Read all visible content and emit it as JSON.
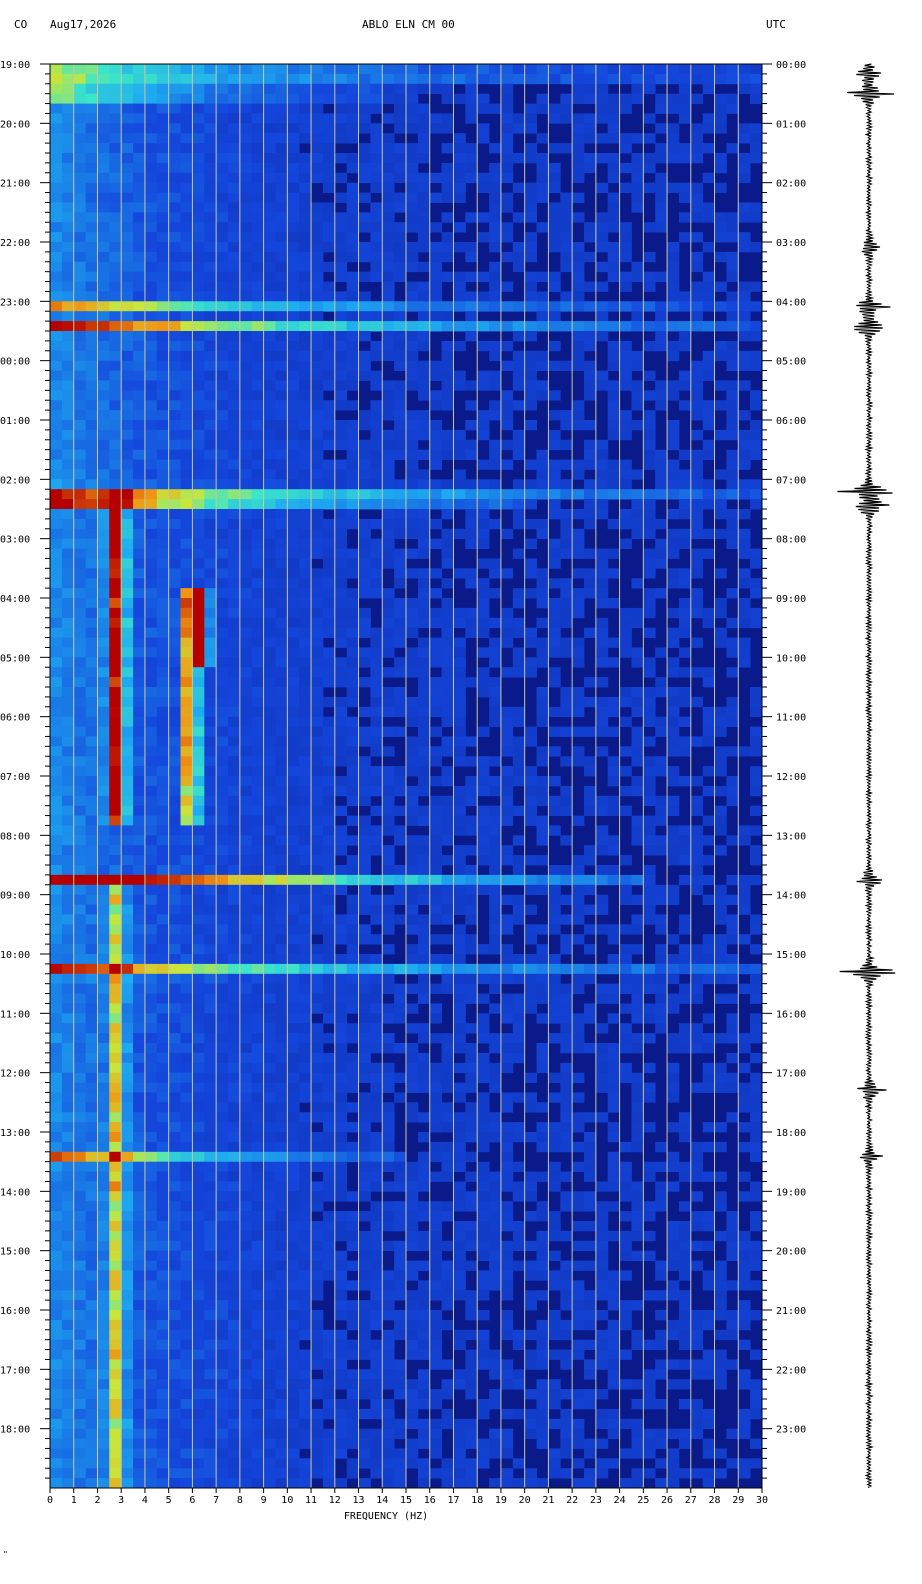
{
  "header": {
    "network": "CO",
    "date": "Aug17,2026",
    "station": "ABLO ELN CM 00",
    "timezone": "UTC"
  },
  "footer_mark": "\"",
  "colors": {
    "background": "#0a1a8a",
    "high": "#b40000",
    "gridline": "#c8c8a0"
  },
  "chart_data": {
    "type": "heatmap",
    "title": "ABLO ELN CM 00",
    "xlabel": "FREQUENCY (HZ)",
    "ylabel": "",
    "xlim": [
      0,
      30
    ],
    "x_ticks": [
      "0",
      "1",
      "2",
      "3",
      "4",
      "5",
      "6",
      "7",
      "8",
      "9",
      "10",
      "11",
      "12",
      "13",
      "14",
      "15",
      "16",
      "17",
      "18",
      "19",
      "20",
      "21",
      "22",
      "23",
      "24",
      "25",
      "26",
      "27",
      "28",
      "29",
      "30"
    ],
    "left_time_labels": [
      "19:00",
      "20:00",
      "21:00",
      "22:00",
      "23:00",
      "00:00",
      "01:00",
      "02:00",
      "03:00",
      "04:00",
      "05:00",
      "06:00",
      "07:00",
      "08:00",
      "09:00",
      "10:00",
      "11:00",
      "12:00",
      "13:00",
      "14:00",
      "15:00",
      "16:00",
      "17:00",
      "18:00"
    ],
    "right_time_labels": [
      "00:00",
      "01:00",
      "02:00",
      "03:00",
      "04:00",
      "05:00",
      "06:00",
      "07:00",
      "08:00",
      "09:00",
      "10:00",
      "11:00",
      "12:00",
      "13:00",
      "14:00",
      "15:00",
      "16:00",
      "17:00",
      "18:00",
      "19:00",
      "20:00",
      "21:00",
      "22:00",
      "23:00"
    ],
    "hours_span": 24,
    "energy_events": [
      {
        "hour": 0.17,
        "intensity": 0.95,
        "fmax": 30
      },
      {
        "hour": 0.5,
        "intensity": 0.85,
        "fmax": 14
      },
      {
        "hour": 4.1,
        "intensity": 0.5,
        "fmax": 30
      },
      {
        "hour": 4.45,
        "intensity": 0.85,
        "fmax": 30
      },
      {
        "hour": 7.2,
        "intensity": 1.0,
        "fmax": 30
      },
      {
        "hour": 7.45,
        "intensity": 0.85,
        "fmax": 20
      },
      {
        "hour": 13.75,
        "intensity": 0.85,
        "fmax": 25
      },
      {
        "hour": 15.3,
        "intensity": 1.0,
        "fmax": 30
      },
      {
        "hour": 18.4,
        "intensity": 0.6,
        "fmax": 15
      }
    ],
    "persistent_bands": [
      {
        "freq_hz": 2.8,
        "start_hour": 7.2,
        "end_hour": 12.8,
        "intensity": 0.85
      },
      {
        "freq_hz": 5.9,
        "start_hour": 8.8,
        "end_hour": 12.8,
        "intensity": 0.75
      },
      {
        "freq_hz": 6.3,
        "start_hour": 8.8,
        "end_hour": 10.2,
        "intensity": 0.8
      },
      {
        "freq_hz": 2.8,
        "start_hour": 13.6,
        "end_hour": 24,
        "intensity": 0.5
      }
    ],
    "seismogram_bursts": [
      {
        "hour": 0.17,
        "amplitude": 0.6
      },
      {
        "hour": 0.5,
        "amplitude": 0.8
      },
      {
        "hour": 3.1,
        "amplitude": 0.4
      },
      {
        "hour": 4.1,
        "amplitude": 0.7
      },
      {
        "hour": 4.45,
        "amplitude": 0.85
      },
      {
        "hour": 7.2,
        "amplitude": 1.0
      },
      {
        "hour": 7.45,
        "amplitude": 0.9
      },
      {
        "hour": 13.75,
        "amplitude": 0.6
      },
      {
        "hour": 15.3,
        "amplitude": 1.0
      },
      {
        "hour": 17.3,
        "amplitude": 0.5
      },
      {
        "hour": 18.4,
        "amplitude": 0.4
      }
    ]
  }
}
